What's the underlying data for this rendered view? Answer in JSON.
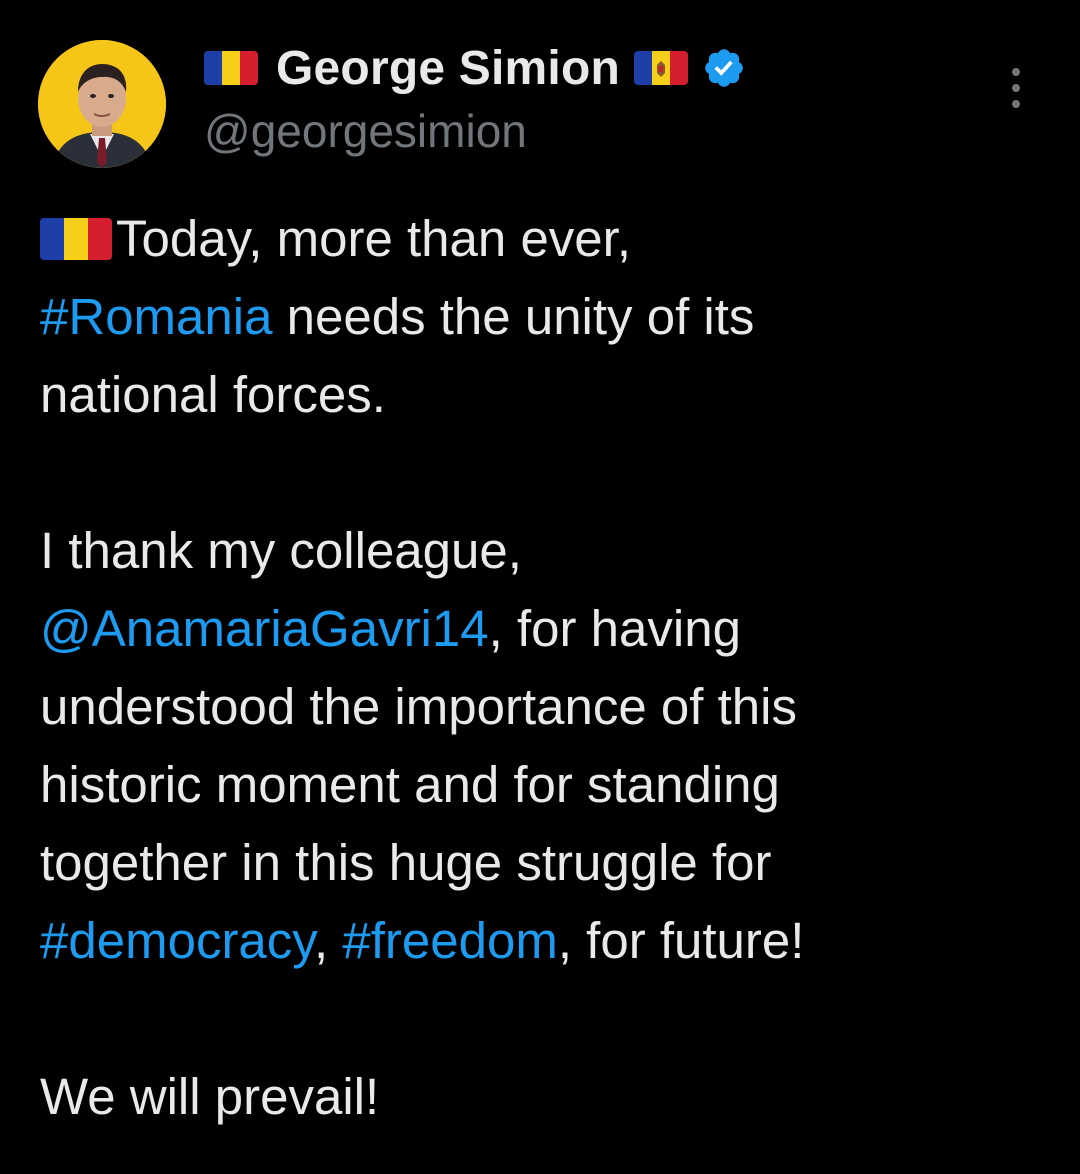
{
  "author": {
    "display_name": "George Simion",
    "handle": "@georgesimion",
    "verified": true,
    "avatar_icon": "profile-photo",
    "flag_left": "romania-flag",
    "flag_right": "moldova-flag"
  },
  "more_icon": "more-vertical-icon",
  "colors": {
    "background": "#000000",
    "text": "#e7e9ea",
    "secondary": "#71767b",
    "link": "#1d9bf0",
    "verified_badge": "#1d9bf0"
  },
  "tweet": {
    "p1_line1": "Today, more than ever,",
    "p1_hashtag_romania": "#Romania",
    "p1_line2_rest": " needs the unity of its",
    "p1_line3": "national forces.",
    "p2_line1": "I thank my colleague,",
    "p2_mention": "@AnamariaGavri14",
    "p2_line2_rest": ", for having",
    "p2_line3": "understood the importance of this",
    "p2_line4": "historic moment and for standing",
    "p2_line5": "together in this huge struggle for",
    "p2_hashtag_democracy": "#democracy",
    "p2_comma": ", ",
    "p2_hashtag_freedom": "#freedom",
    "p2_line6_rest": ", for future!",
    "p3_line1": "We will prevail!"
  }
}
